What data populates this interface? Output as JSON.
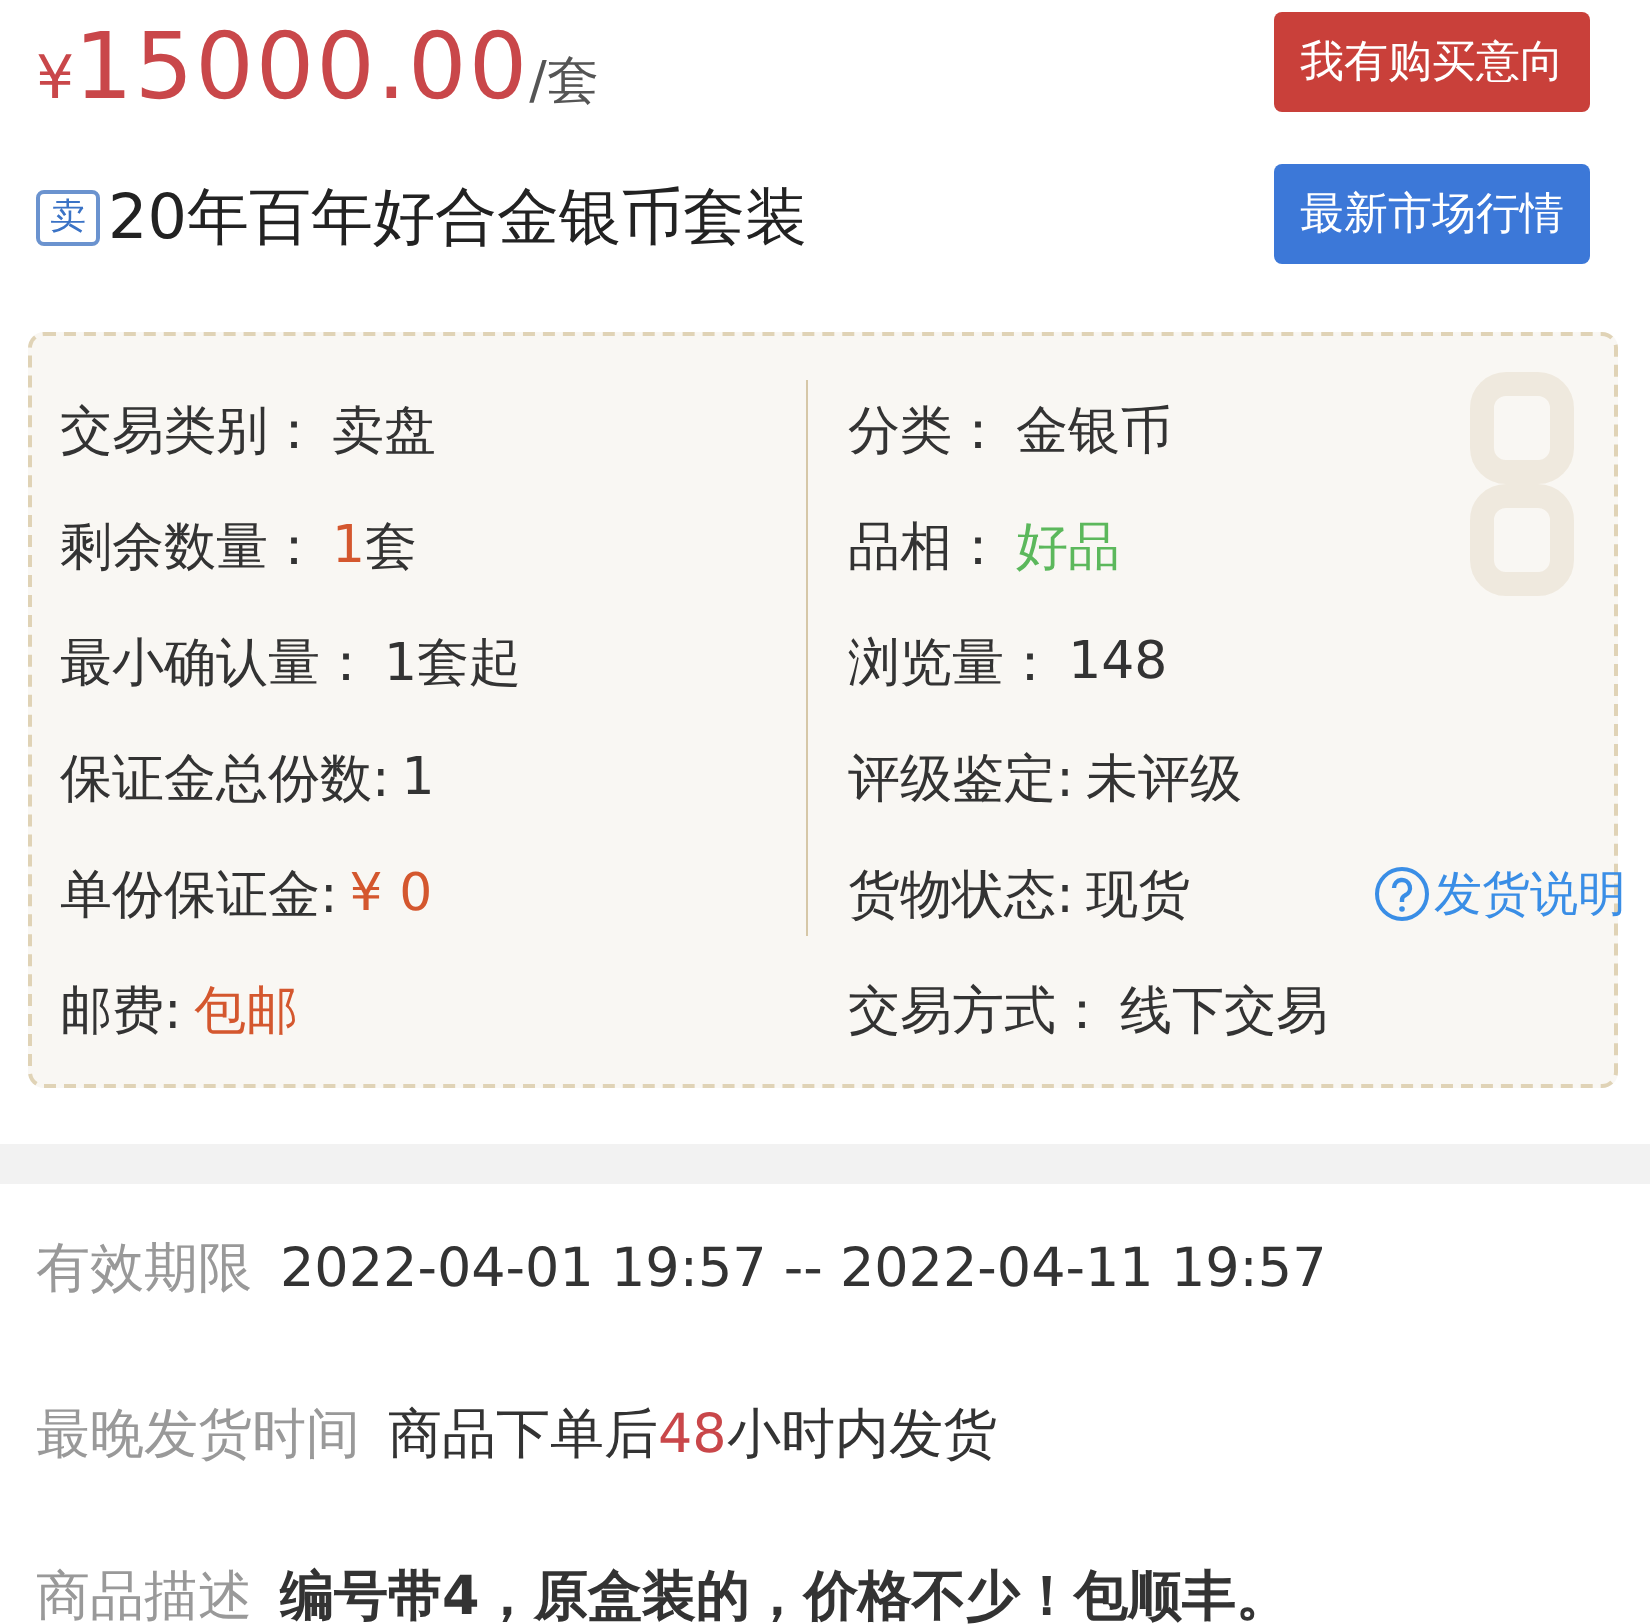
{
  "price": {
    "currency": "¥",
    "amount": "15000.00",
    "unit": "/套"
  },
  "title": {
    "badge": "卖",
    "text": "20年百年好合金银币套装"
  },
  "buttons": [
    {
      "label": "我有购买意向",
      "kind": "primary"
    },
    {
      "label": "最新市场行情",
      "kind": "info"
    }
  ],
  "details": {
    "left": [
      {
        "label": "交易类别：",
        "value": "卖盘"
      },
      {
        "label": "剩余数量：",
        "value": "1",
        "suffix": "套",
        "color": "#d4572e"
      },
      {
        "label": "最小确认量：",
        "value": "1套起"
      },
      {
        "label": "保证金总份数:",
        "value": "1"
      },
      {
        "label": "单份保证金:",
        "value": "¥ 0",
        "color": "#d4572e"
      },
      {
        "label": "邮费:",
        "value": "包邮",
        "color": "#d4572e"
      }
    ],
    "right": [
      {
        "label": "分类：",
        "value": "金银币"
      },
      {
        "label": "品相：",
        "value": "好品",
        "color": "#5cb85c"
      },
      {
        "label": "浏览量：",
        "value": "148"
      },
      {
        "label": "评级鉴定:",
        "value": "未评级"
      },
      {
        "label": "货物状态:",
        "value": "现货",
        "link": "发货说明"
      },
      {
        "label": "交易方式：",
        "value": "线下交易"
      }
    ]
  },
  "info": [
    {
      "label": "有效期限",
      "text": "2022-04-01 19:57 -- 2022-04-11 19:57",
      "bold": false
    },
    {
      "label": "最晚发货时间",
      "text": "商品下单后",
      "highlight": "48",
      "suffix": "小时内发货",
      "bold": false
    },
    {
      "label": "商品描述",
      "text": "编号带4，原盒装的，价格不少！包顺丰。",
      "bold": true
    }
  ]
}
